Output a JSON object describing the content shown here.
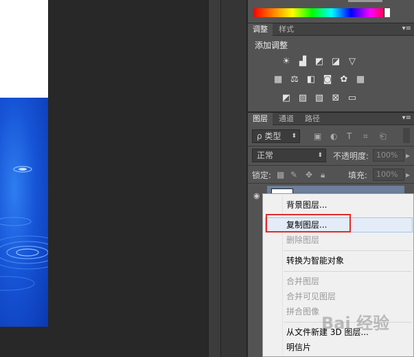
{
  "color_panel": {},
  "adjustments_panel": {
    "tabs": [
      "调整",
      "样式"
    ],
    "title": "添加调整",
    "row1_icons": [
      "brightness-icon",
      "levels-icon",
      "curves-icon",
      "exposure-icon",
      "vibrance-icon"
    ],
    "row2_icons": [
      "hue-saturation-icon",
      "color-balance-icon",
      "black-white-icon",
      "photo-filter-icon",
      "channel-mixer-icon",
      "color-lookup-icon"
    ],
    "row3_icons": [
      "invert-icon",
      "posterize-icon",
      "threshold-icon",
      "selective-color-icon",
      "gradient-map-icon"
    ]
  },
  "layers_panel": {
    "tabs": [
      "图层",
      "通道",
      "路径"
    ],
    "filter_label": "ρ 类型",
    "blend_mode": "正常",
    "opacity_label": "不透明度:",
    "opacity_value": "100%",
    "lock_label": "锁定:",
    "fill_label": "填充:",
    "fill_value": "100%"
  },
  "context_menu": {
    "items": [
      {
        "label": "背景图层...",
        "disabled": false
      },
      {
        "label": "复制图层...",
        "disabled": false,
        "highlighted": true
      },
      {
        "label": "删除图层",
        "disabled": true
      },
      {
        "label": "转换为智能对象",
        "disabled": false
      },
      {
        "label": "合并图层",
        "disabled": true
      },
      {
        "label": "合并可见图层",
        "disabled": true
      },
      {
        "label": "拼合图像",
        "disabled": true
      },
      {
        "label": "从文件新建 3D 图层...",
        "disabled": false
      },
      {
        "label": "明信片",
        "disabled": false
      }
    ]
  },
  "highlight_color": "#e22a2a",
  "watermark": "Bai 经验"
}
